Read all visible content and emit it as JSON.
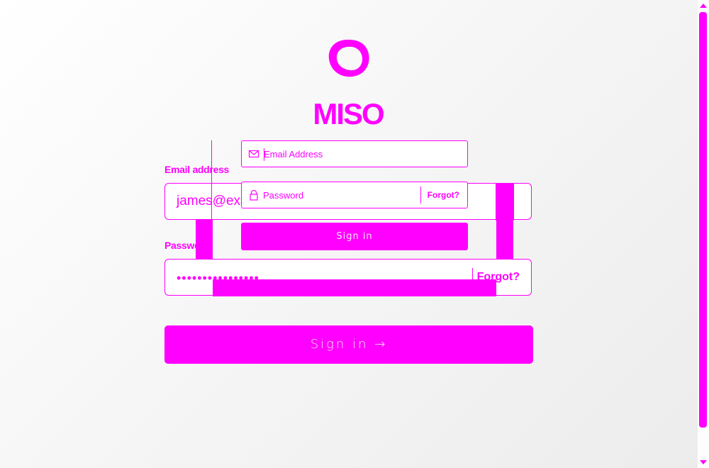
{
  "brand": {
    "name": "MISO",
    "color": "#ff00ff"
  },
  "background_form": {
    "email_label": "Email address",
    "email_value": "james@example.com",
    "password_label": "Password",
    "password_value": "••••••••••••••••",
    "forgot_label": "Forgot?",
    "signin_label": "Sign in →"
  },
  "front_form": {
    "email_placeholder": "Email Address",
    "email_icon": "envelope-icon",
    "password_placeholder": "Password",
    "password_icon": "lock-icon",
    "forgot_label": "Forgot?",
    "signin_label": "Sign in"
  },
  "colors": {
    "accent": "#ff00ff",
    "field_bg": "#ffffff",
    "button_text": "#ffe6ff"
  }
}
